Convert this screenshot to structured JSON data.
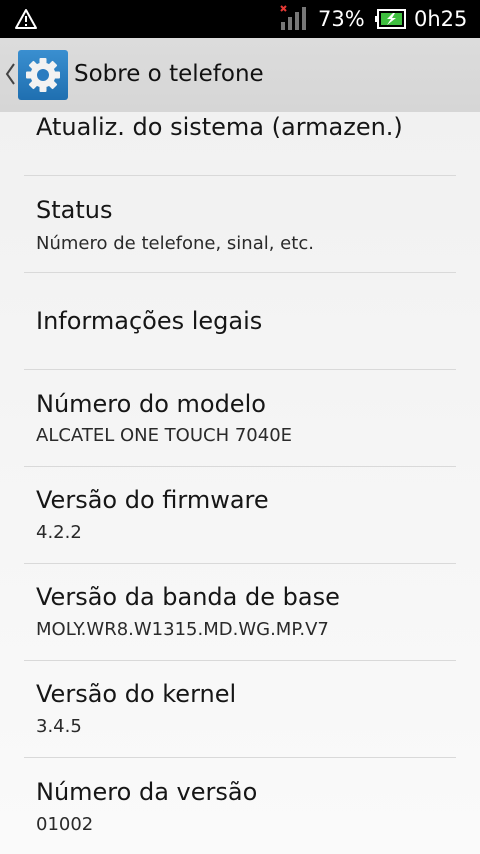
{
  "status_bar": {
    "battery_percent": "73%",
    "time": "0h25"
  },
  "action_bar": {
    "title": "Sobre o telefone"
  },
  "items": [
    {
      "title": "Atualiz. do sistema (armazen.)",
      "summary": ""
    },
    {
      "title": "Status",
      "summary": "Número de telefone, sinal, etc."
    },
    {
      "title": "Informações legais",
      "summary": ""
    },
    {
      "title": "Número do modelo",
      "summary": "ALCATEL ONE TOUCH 7040E"
    },
    {
      "title": "Versão do firmware",
      "summary": "4.2.2"
    },
    {
      "title": "Versão da banda de base",
      "summary": "MOLY.WR8.W1315.MD.WG.MP.V7"
    },
    {
      "title": "Versão do kernel",
      "summary": "3.4.5"
    },
    {
      "title": "Número da versão",
      "summary": "01002"
    }
  ]
}
